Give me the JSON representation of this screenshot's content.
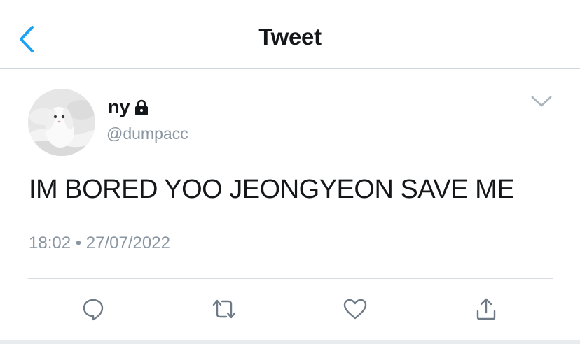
{
  "header": {
    "title": "Tweet",
    "back_icon": "chevron-left-icon"
  },
  "tweet": {
    "display_name": "ny",
    "protected_icon": "lock-icon",
    "handle": "@dumpacc",
    "text": "IM BORED YOO JEONGYEON SAVE ME",
    "timestamp": "18:02 • 27/07/2022",
    "avatar": "white-rabbit-photo",
    "menu_icon": "chevron-down-icon"
  },
  "actions": [
    {
      "name": "reply",
      "icon": "reply-icon"
    },
    {
      "name": "retweet",
      "icon": "retweet-icon"
    },
    {
      "name": "like",
      "icon": "heart-icon"
    },
    {
      "name": "share",
      "icon": "share-icon"
    }
  ],
  "colors": {
    "accent": "#1da1f2",
    "text": "#14171a",
    "secondary": "#8a96a1",
    "divider": "#d6dce1"
  }
}
